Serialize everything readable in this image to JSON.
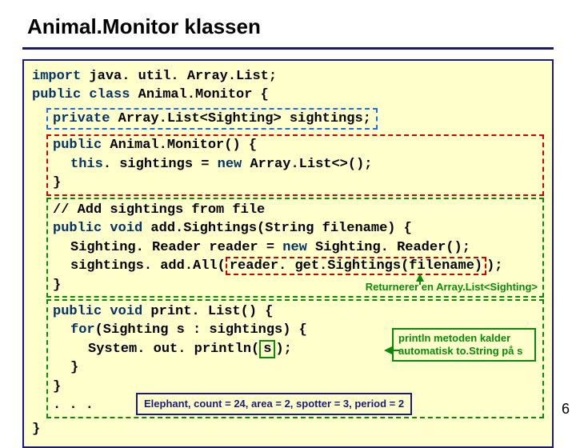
{
  "title": "Animal.Monitor klassen",
  "code": {
    "l1a": "import",
    "l1b": " java. util. Array.List;",
    "l2a": "public class",
    "l2b": " Animal.Monitor {",
    "decl_a": "private",
    "decl_b": " Array.List<Sighting> sightings;",
    "ctor1a": "public",
    "ctor1b": " Animal.Monitor() {",
    "ctor2a": "this",
    "ctor2b": ". sightings = ",
    "ctor2c": "new",
    "ctor2d": " Array.List<>();",
    "ctor3": "}",
    "add1": "// Add sightings from file",
    "add2a": "public void",
    "add2b": " add.Sightings(String filename) {",
    "add3a": "Sighting. Reader reader = ",
    "add3b": "new",
    "add3c": " Sighting. Reader();",
    "add4a": "sightings. add.All(",
    "add4b": "reader. get.Sightings(filename)",
    "add4c": ");",
    "add5": "}",
    "print1a": "public void",
    "print1b": " print. List() {",
    "print2a": "for",
    "print2b": "(Sighting s : sightings) {",
    "print3a": "System. out. println(",
    "print3b": "s",
    "print3c": ");",
    "print4": "}",
    "print5": "}",
    "print6": ". . .",
    "end": "}"
  },
  "callouts": {
    "returns": "Returnerer en Array.List<Sighting>",
    "println1": "println metoden kalder",
    "println2": "automatisk to.String på s",
    "elephant": "Elephant, count = 24, area = 2, spotter = 3, period = 2"
  },
  "pageNum": "6"
}
